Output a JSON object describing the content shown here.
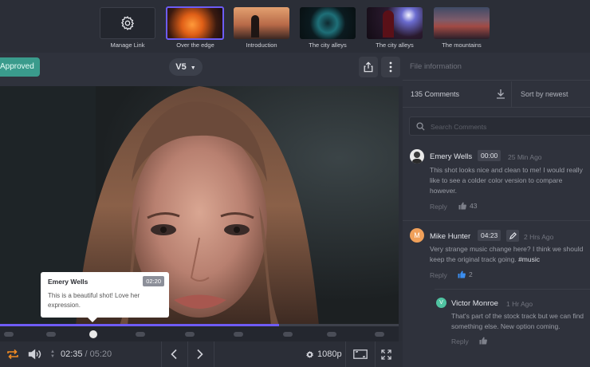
{
  "thumbnails": [
    {
      "label": "Manage Link",
      "icon": "gear-icon"
    },
    {
      "label": "Over the edge",
      "active": true
    },
    {
      "label": "Introduction"
    },
    {
      "label": "The city alleys"
    },
    {
      "label": "The city alleys"
    },
    {
      "label": "The mountains"
    }
  ],
  "toolbar": {
    "status": "Approved",
    "version": "V5"
  },
  "tooltip": {
    "name": "Emery Wells",
    "time": "02:20",
    "text": "This is a beautiful shot! Love her expression."
  },
  "player": {
    "current": "02:35",
    "separator": "/",
    "duration": "05:20",
    "quality": "1080p",
    "progress_fraction": 0.7
  },
  "panel": {
    "title": "File information",
    "comment_count": "135 Comments",
    "sort": "Sort by newest",
    "search_placeholder": "Search Comments"
  },
  "comments": [
    {
      "name": "Emery Wells",
      "time": "00:00",
      "ago": "25 Min Ago",
      "text": "This shot looks nice and clean to me! I would really like to see a colder color version to compare however.",
      "reply": "Reply",
      "likes": "43"
    },
    {
      "name": "Mike Hunter",
      "time": "04:23",
      "ago": "2 Hrs Ago",
      "text": "Very strange music change here? I think we should keep the original track going.",
      "tag": "#music",
      "reply": "Reply",
      "likes": "2",
      "initial": "M"
    },
    {
      "name": "Victor Monroe",
      "ago": "1 Hr Ago",
      "text": "That's part of the stock track but we can find something else. New option coming.",
      "reply": "Reply",
      "initial": "V"
    }
  ],
  "colors": {
    "accent": "#6f5cf6",
    "approved": "#3a9b8c",
    "orange": "#f08a24",
    "like_active": "#3b8ef0"
  }
}
